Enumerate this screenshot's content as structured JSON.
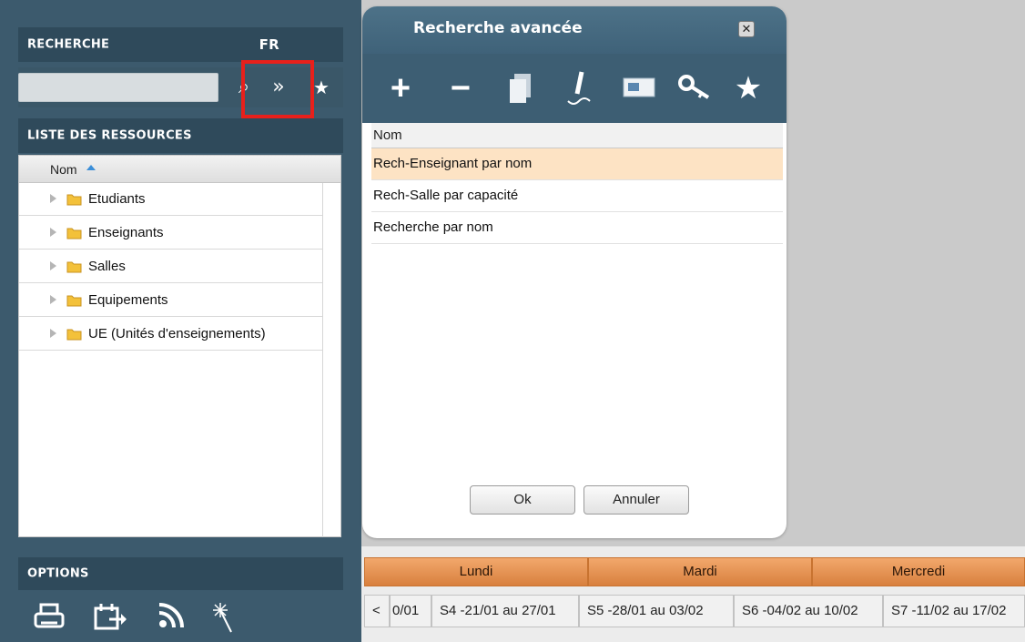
{
  "search": {
    "header": "RECHERCHE",
    "lang": "FR",
    "input_value": "",
    "buttons": [
      {
        "icon": "search-icon",
        "glyph": "⌕"
      },
      {
        "icon": "expand-double-chevron-icon",
        "glyph": "»"
      },
      {
        "icon": "star-icon",
        "glyph": "★"
      }
    ]
  },
  "resources": {
    "header": "LISTE DES RESSOURCES",
    "column": "Nom",
    "items": [
      {
        "label": "Etudiants"
      },
      {
        "label": "Enseignants"
      },
      {
        "label": "Salles"
      },
      {
        "label": "Equipements"
      },
      {
        "label": "UE (Unités d'enseignements)"
      }
    ]
  },
  "options": {
    "header": "OPTIONS",
    "icons": [
      "print-icon",
      "export-calendar-icon",
      "rss-feed-icon",
      "magic-wand-icon"
    ]
  },
  "dialog": {
    "title": "Recherche avancée",
    "close_label": "✕",
    "toolbar": [
      {
        "icon": "add-icon",
        "glyph": "+"
      },
      {
        "icon": "remove-icon",
        "glyph": "−"
      },
      {
        "icon": "copy-icon",
        "glyph": "⧉"
      },
      {
        "icon": "edit-pen-icon",
        "glyph": "✎"
      },
      {
        "icon": "card-icon",
        "glyph": "▭"
      },
      {
        "icon": "key-icon",
        "glyph": "⚷"
      },
      {
        "icon": "favorite-star-icon",
        "glyph": "★"
      }
    ],
    "column": "Nom",
    "rows": [
      {
        "label": "Rech-Enseignant par nom",
        "selected": true
      },
      {
        "label": "Rech-Salle par capacité",
        "selected": false
      },
      {
        "label": "Recherche par nom",
        "selected": false
      }
    ],
    "ok_label": "Ok",
    "cancel_label": "Annuler"
  },
  "calendar": {
    "days": [
      "Lundi",
      "Mardi",
      "Mercredi"
    ],
    "weeks": {
      "prev_label": "<",
      "items": [
        "0/01",
        "S4 -21/01 au 27/01",
        "S5 -28/01 au 03/02",
        "S6 -04/02 au 10/02",
        "S7 -11/02 au 17/02"
      ]
    }
  },
  "colors": {
    "panel": "#3c5a6d",
    "header": "#2f4a5b",
    "highlight_box": "#e8201b",
    "selected_row": "#fde3c4",
    "day_orange": "#e5904e"
  }
}
